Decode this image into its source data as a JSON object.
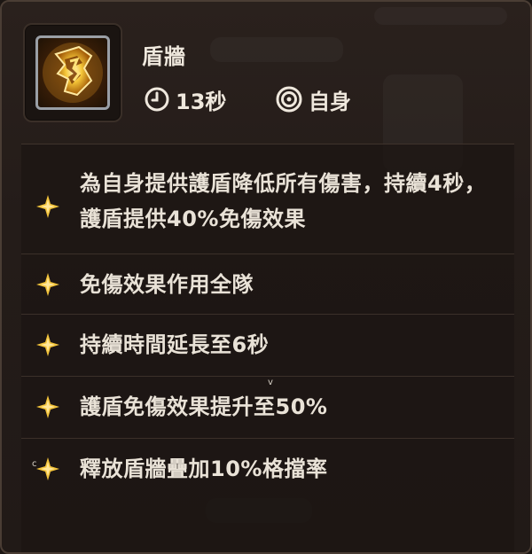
{
  "skill": {
    "name": "盾牆",
    "icon": "golden-shield-wall-icon",
    "cooldown": "13秒",
    "cooldown_icon": "clock-icon",
    "target": "自身",
    "target_icon": "target-icon"
  },
  "effects": [
    {
      "bullet_icon": "four-point-star-icon",
      "text": "為自身提供護盾降低所有傷害，持續4秒，護盾提供40%免傷效果"
    },
    {
      "bullet_icon": "four-point-star-icon",
      "text": "免傷效果作用全隊"
    },
    {
      "bullet_icon": "four-point-star-icon",
      "text": "持續時間延長至6秒"
    },
    {
      "bullet_icon": "four-point-star-icon",
      "text": "護盾免傷效果提升至50%"
    },
    {
      "bullet_icon": "four-point-star-icon",
      "text": "釋放盾牆疊加10%格擋率"
    }
  ],
  "stray_glyphs": {
    "v": "v",
    "c": "c"
  },
  "colors": {
    "background": "#231b18",
    "text": "#efe8dd",
    "accent_gold": "#f3c33a",
    "border": "#4a3d34"
  }
}
